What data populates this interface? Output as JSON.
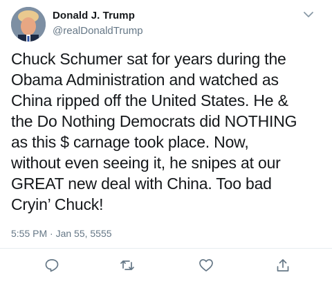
{
  "user": {
    "display_name": "Donald J. Trump",
    "handle": "@realDonaldTrump",
    "avatar_icon": "profile-photo"
  },
  "tweet": {
    "text": "Chuck Schumer sat for years during the\nObama Administration and watched as\nChina ripped off the United States. He &\nthe Do Nothing Democrats did NOTHING\nas this $ carnage took place. Now,\nwithout even seeing it, he snipes at our\nGREAT new deal with China. Too bad\nCryin’ Chuck!",
    "timestamp": "5:55 PM · Jan 55, 5555"
  },
  "actions": {
    "reply_icon": "reply-icon",
    "retweet_icon": "retweet-icon",
    "like_icon": "heart-icon",
    "share_icon": "share-icon"
  },
  "colors": {
    "text_primary": "#14171a",
    "text_secondary": "#657786",
    "icon_gray": "#657786",
    "divider": "#e6ecf0"
  }
}
